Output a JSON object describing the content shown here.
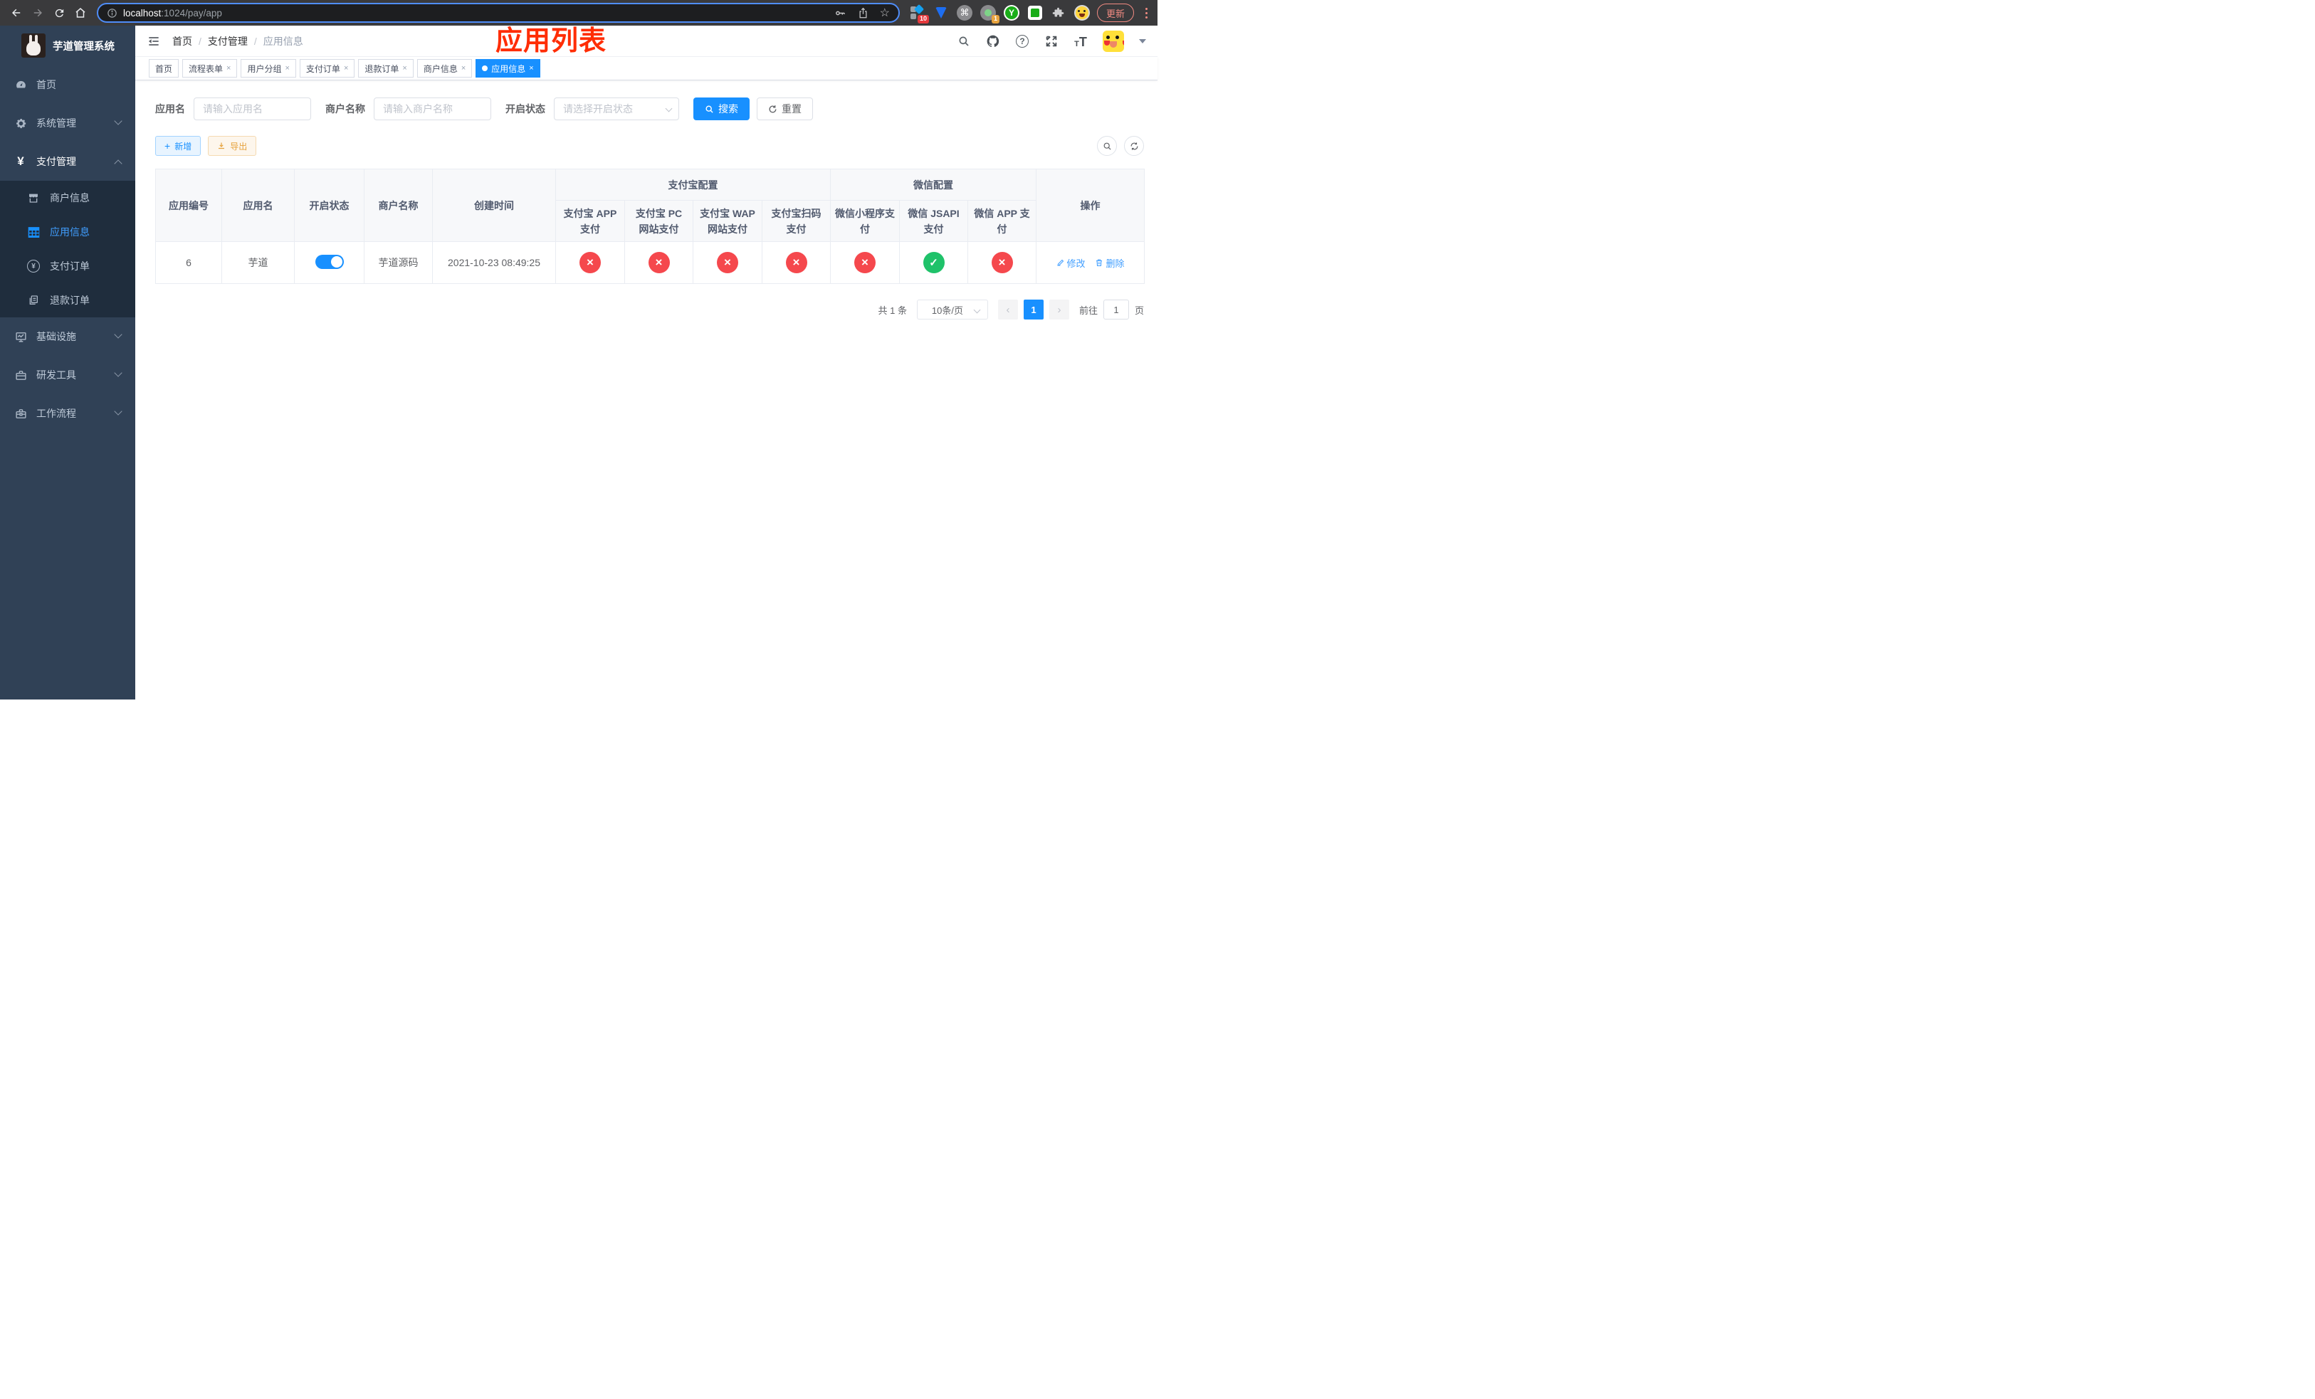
{
  "browser": {
    "url_host": "localhost",
    "url_rest": ":1024/pay/app",
    "ext_badge_1": "10",
    "ext_badge_2": "1",
    "ext_y_label": "Y",
    "update_label": "更新"
  },
  "sidebar": {
    "title": "芋道管理系统",
    "items": [
      {
        "label": "首页"
      },
      {
        "label": "系统管理"
      },
      {
        "label": "支付管理"
      },
      {
        "label": "商户信息"
      },
      {
        "label": "应用信息"
      },
      {
        "label": "支付订单"
      },
      {
        "label": "退款订单"
      },
      {
        "label": "基础设施"
      },
      {
        "label": "研发工具"
      },
      {
        "label": "工作流程"
      }
    ]
  },
  "header": {
    "breadcrumb": [
      "首页",
      "支付管理",
      "应用信息"
    ],
    "overlay_title": "应用列表"
  },
  "tabs": [
    {
      "label": "首页"
    },
    {
      "label": "流程表单"
    },
    {
      "label": "用户分组"
    },
    {
      "label": "支付订单"
    },
    {
      "label": "退款订单"
    },
    {
      "label": "商户信息"
    },
    {
      "label": "应用信息"
    }
  ],
  "filters": {
    "app_name_label": "应用名",
    "app_name_placeholder": "请输入应用名",
    "merchant_label": "商户名称",
    "merchant_placeholder": "请输入商户名称",
    "status_label": "开启状态",
    "status_placeholder": "请选择开启状态",
    "search_label": "搜索",
    "reset_label": "重置"
  },
  "toolbar": {
    "add_label": "新增",
    "export_label": "导出"
  },
  "table": {
    "groups": {
      "alipay": "支付宝配置",
      "wechat": "微信配置"
    },
    "columns": {
      "id": "应用编号",
      "name": "应用名",
      "status": "开启状态",
      "merchant": "商户名称",
      "created": "创建时间",
      "alipay_app": "支付宝 APP 支付",
      "alipay_pc": "支付宝 PC 网站支付",
      "alipay_wap": "支付宝 WAP 网站支付",
      "alipay_qr": "支付宝扫码支付",
      "wx_lite": "微信小程序支付",
      "wx_jsapi": "微信 JSAPI 支付",
      "wx_app": "微信 APP 支付",
      "actions": "操作"
    },
    "row": {
      "id": "6",
      "name": "芋道",
      "status_on": true,
      "merchant": "芋道源码",
      "created": "2021-10-23 08:49:25",
      "alipay_app": false,
      "alipay_pc": false,
      "alipay_wap": false,
      "alipay_qr": false,
      "wx_lite": false,
      "wx_jsapi": true,
      "wx_app": false,
      "edit_label": "修改",
      "delete_label": "删除"
    }
  },
  "pagination": {
    "total": "共 1 条",
    "page_size": "10条/页",
    "current_page": "1",
    "goto_label": "前往",
    "goto_value": "1",
    "page_unit": "页"
  },
  "colors": {
    "accent": "#1890ff",
    "sidebar_active": "#409eff",
    "success": "#1fc26a",
    "danger": "#f5484d",
    "warning": "#e6a23c",
    "sidebar_bg": "#304156",
    "submenu_bg": "#1f2d3d"
  }
}
